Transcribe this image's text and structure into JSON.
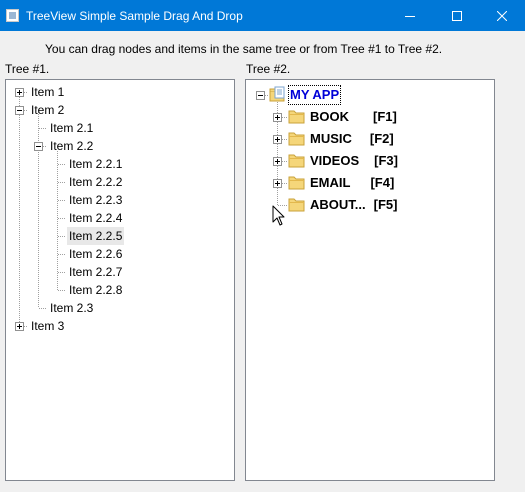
{
  "window": {
    "title": "TreeView Simple Sample Drag And Drop",
    "buttons": {
      "minimize": "minimize",
      "maximize": "maximize",
      "close": "close"
    }
  },
  "description": "You can drag nodes and items in the same tree or from Tree #1 to Tree #2.",
  "tree1": {
    "label": "Tree #1.",
    "nodes": [
      {
        "text": "Item 1"
      },
      {
        "text": "Item 2"
      },
      {
        "text": "Item 2.1"
      },
      {
        "text": "Item 2.2"
      },
      {
        "text": "Item 2.2.1"
      },
      {
        "text": "Item 2.2.2"
      },
      {
        "text": "Item 2.2.3"
      },
      {
        "text": "Item 2.2.4"
      },
      {
        "text": "Item 2.2.5"
      },
      {
        "text": "Item 2.2.6"
      },
      {
        "text": "Item 2.2.7"
      },
      {
        "text": "Item 2.2.8"
      },
      {
        "text": "Item 2.3"
      },
      {
        "text": "Item 3"
      }
    ]
  },
  "tree2": {
    "label": "Tree #2.",
    "root": "MY APP",
    "children": [
      {
        "text": "BOOK",
        "key": "[F1]"
      },
      {
        "text": "MUSIC",
        "key": "[F2]"
      },
      {
        "text": "VIDEOS",
        "key": "[F3]"
      },
      {
        "text": "EMAIL",
        "key": "[F4]"
      },
      {
        "text": "ABOUT...",
        "key": "[F5]"
      }
    ]
  },
  "colors": {
    "titlebar": "#0078d7",
    "root_text": "#0000d8",
    "folder": "#f5d67a",
    "hover": "#e8e8e8"
  }
}
